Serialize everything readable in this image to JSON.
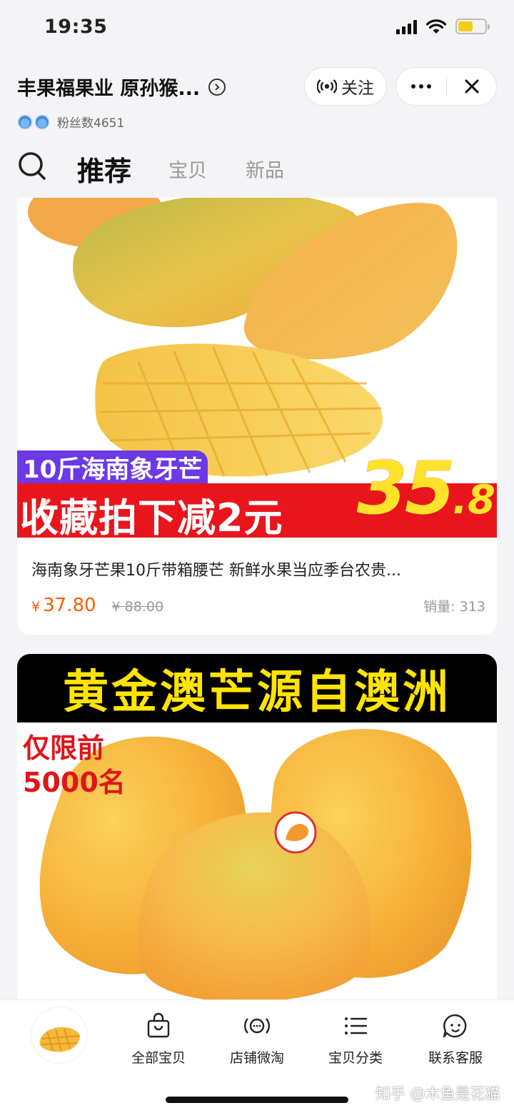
{
  "status_bar": {
    "time": "19:35",
    "battery_level": 0.55
  },
  "shop": {
    "name": "丰果福果业 原孙猴...",
    "follow_label": "关注",
    "fans_text": "粉丝数4651"
  },
  "tabs": [
    {
      "label": "推荐",
      "active": true
    },
    {
      "label": "宝贝",
      "active": false
    },
    {
      "label": "新品",
      "active": false
    }
  ],
  "products": [
    {
      "banner_tag": "10斤海南象牙芒",
      "banner_promo": "收藏拍下减2元",
      "banner_price_main": "35",
      "banner_price_decimal": ".8",
      "title": "海南象牙芒果10斤带箱腰芒 新鲜水果当应季台农贵...",
      "currency": "¥",
      "price": "37.80",
      "original_price": "¥ 88.00",
      "sales": "销量: 313"
    },
    {
      "banner_title": "黄金澳芒源自澳洲",
      "limited_line1": "仅限前",
      "limited_line2": "5000名"
    }
  ],
  "bottom_nav": [
    {
      "label": "全部宝贝",
      "icon": "bag-icon"
    },
    {
      "label": "店铺微淘",
      "icon": "broadcast-icon"
    },
    {
      "label": "宝贝分类",
      "icon": "list-icon"
    },
    {
      "label": "联系客服",
      "icon": "chat-bubble-icon"
    }
  ],
  "watermark": "知乎 @木鱼是花猫",
  "colors": {
    "price_orange": "#ff5a00",
    "promo_red": "#e8161c",
    "promo_purple": "#6b39e6",
    "promo_yellow": "#ffe32a",
    "mango_yellow": "#f6b93b"
  }
}
